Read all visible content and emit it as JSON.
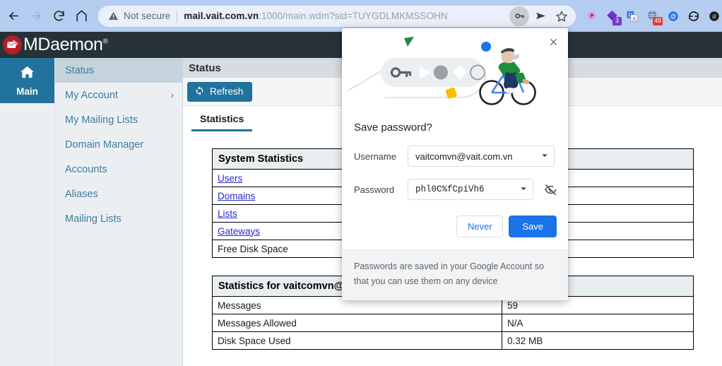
{
  "browser": {
    "nav": {
      "back_icon": "arrow-left-icon",
      "forward_icon": "arrow-right-icon",
      "reload_icon": "reload-icon",
      "home_icon": "home-icon"
    },
    "omnibox": {
      "security_icon": "warning-triangle-icon",
      "security_text": "Not secure",
      "url_host": "mail.vait.com.vn",
      "url_rest": ":1000/main.wdm?sid=TUYGDLMKMSSOHN",
      "url_full": "mail.vait.com.vn:1000/main.wdm?sid=TUYGDLMKMSSOHN",
      "key_icon": "key-icon",
      "share_icon": "send-arrow-icon",
      "bookmark_icon": "star-icon"
    },
    "extensions": [
      {
        "name": "extension-icon-purple-circle",
        "color": "#d6a8dd",
        "badge": "",
        "badge_color": ""
      },
      {
        "name": "extension-icon-diamond",
        "color": "#5b1fb5",
        "badge": "3",
        "badge_color": "#7a36c9"
      },
      {
        "name": "extension-icon-translate",
        "color": "#3b78e7",
        "badge": "",
        "badge_color": ""
      },
      {
        "name": "extension-icon-globe",
        "color": "#4b6b8a",
        "badge": "48",
        "badge_color": "#e33a2e"
      },
      {
        "name": "extension-icon-at-sign",
        "color": "#1a73e8",
        "badge": "",
        "badge_color": ""
      },
      {
        "name": "extension-icon-sync",
        "color": "#202124",
        "badge": "",
        "badge_color": ""
      },
      {
        "name": "extension-icon-partial",
        "color": "#202124",
        "badge": "",
        "badge_color": ""
      }
    ]
  },
  "app": {
    "brand": "MDaemon",
    "brand_mark": "®",
    "logo_icon": "mdaemon-envelope-logo"
  },
  "rail": {
    "main_label": "Main",
    "main_icon": "home-icon"
  },
  "sidebar": {
    "items": [
      {
        "label": "Status",
        "active": true,
        "chevron": ""
      },
      {
        "label": "My Account",
        "active": false,
        "chevron": "›"
      },
      {
        "label": "My Mailing Lists",
        "active": false,
        "chevron": ""
      },
      {
        "label": "Domain Manager",
        "active": false,
        "chevron": ""
      },
      {
        "label": "Accounts",
        "active": false,
        "chevron": ""
      },
      {
        "label": "Aliases",
        "active": false,
        "chevron": ""
      },
      {
        "label": "Mailing Lists",
        "active": false,
        "chevron": ""
      }
    ]
  },
  "content": {
    "page_title": "Status",
    "refresh_label": "Refresh",
    "refresh_icon": "refresh-icon",
    "tab_label": "Statistics",
    "system_table": {
      "header": "System Statistics",
      "rows": [
        {
          "key": "Users",
          "link": true,
          "value": ""
        },
        {
          "key": "Domains",
          "link": true,
          "value": ""
        },
        {
          "key": "Lists",
          "link": true,
          "value": ""
        },
        {
          "key": "Gateways",
          "link": true,
          "value": ""
        },
        {
          "key": "Free Disk Space",
          "link": false,
          "value": ""
        }
      ]
    },
    "account_table": {
      "header": "Statistics for vaitcomvn@vaitcomvn",
      "rows": [
        {
          "key": "Messages",
          "value": "59"
        },
        {
          "key": "Messages Allowed",
          "value": "N/A"
        },
        {
          "key": "Disk Space Used",
          "value": "0.32 MB"
        }
      ]
    }
  },
  "password_dialog": {
    "close_icon": "close-icon",
    "hero_icon": "save-password-illustration",
    "title": "Save password?",
    "username_label": "Username",
    "username_value": "vaitcomvn@vait.com.vn",
    "username_caret_icon": "chevron-down-icon",
    "password_label": "Password",
    "password_value": "phl0C%fCpiVh6",
    "password_caret_icon": "chevron-down-icon",
    "reveal_icon": "eye-slash-icon",
    "never_label": "Never",
    "save_label": "Save",
    "footer_text": "Passwords are saved in your Google Account so that you can use them on any device"
  },
  "colors": {
    "chrome_toolbar": "#b5cdf0",
    "mdaemon_header": "#263238",
    "accent_blue": "#21729c",
    "link_blue": "#2a2aca",
    "google_blue": "#1a73e8",
    "logo_red": "#b51f24"
  }
}
